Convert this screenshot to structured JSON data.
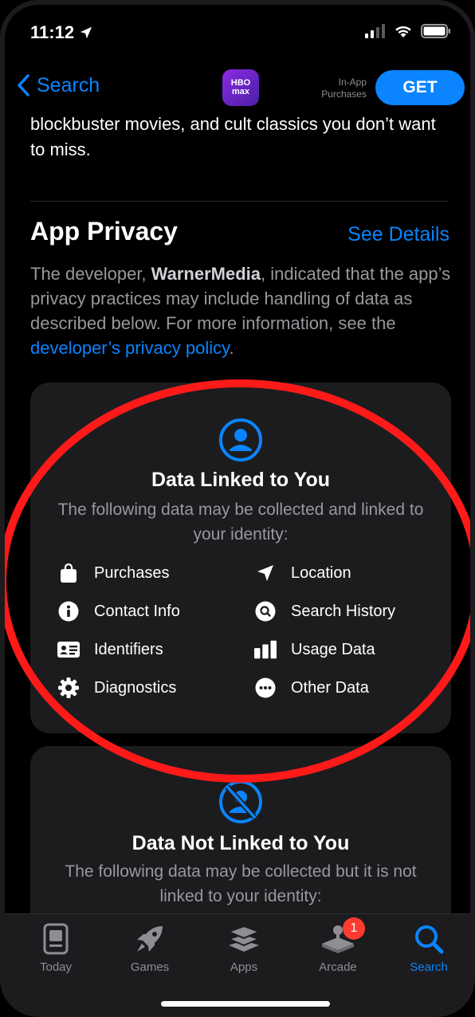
{
  "status": {
    "time": "11:12"
  },
  "nav": {
    "back_label": "Search",
    "app_logo_text": [
      "HBO",
      "max"
    ],
    "in_app_line1": "In-App",
    "in_app_line2": "Purchases",
    "get_label": "GET"
  },
  "description": {
    "tail": "blockbuster movies, and cult classics you don’t want to miss."
  },
  "privacy": {
    "title": "App Privacy",
    "see_details": "See Details",
    "desc_pre": "The developer, ",
    "developer": "WarnerMedia",
    "desc_mid": ", indicated that the app’s privacy practices may include handling of data as described below. For more information, see the ",
    "policy_link": "developer’s privacy policy",
    "desc_end": "."
  },
  "linked": {
    "title": "Data Linked to You",
    "subtitle": "The following data may be collected and linked to your identity:",
    "items": [
      {
        "label": "Purchases",
        "icon": "bag-icon"
      },
      {
        "label": "Location",
        "icon": "location-arrow-icon"
      },
      {
        "label": "Contact Info",
        "icon": "info-icon"
      },
      {
        "label": "Search History",
        "icon": "search-history-icon"
      },
      {
        "label": "Identifiers",
        "icon": "id-card-icon"
      },
      {
        "label": "Usage Data",
        "icon": "bar-chart-icon"
      },
      {
        "label": "Diagnostics",
        "icon": "gear-icon"
      },
      {
        "label": "Other Data",
        "icon": "ellipsis-icon"
      }
    ]
  },
  "not_linked": {
    "title": "Data Not Linked to You",
    "subtitle": "The following data may be collected but it is not linked to your identity:"
  },
  "tabbar": {
    "tabs": [
      {
        "label": "Today",
        "icon": "today-icon"
      },
      {
        "label": "Games",
        "icon": "rocket-icon"
      },
      {
        "label": "Apps",
        "icon": "layers-icon"
      },
      {
        "label": "Arcade",
        "icon": "joystick-icon",
        "badge": "1"
      },
      {
        "label": "Search",
        "icon": "search-icon",
        "active": true
      }
    ]
  },
  "colors": {
    "accent": "#0a84ff",
    "annotation": "#ff1a1a",
    "badge": "#ff3b30"
  }
}
